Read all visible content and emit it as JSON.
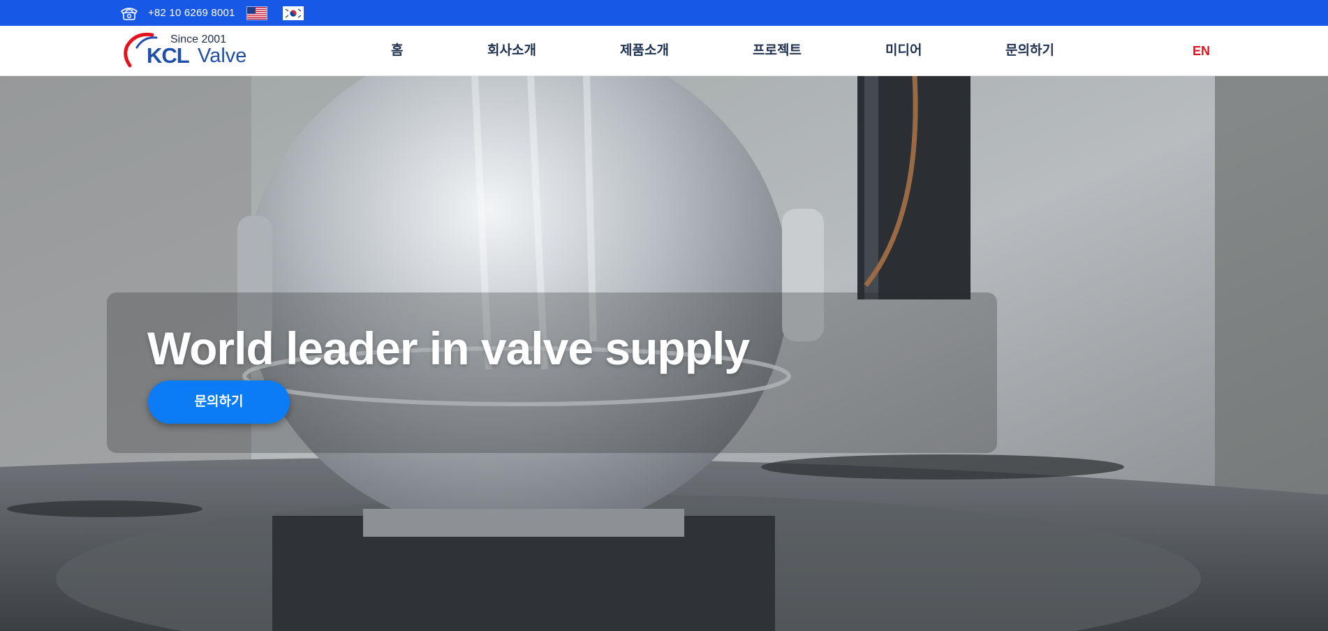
{
  "topbar": {
    "phone_icon": "phone-icon",
    "phone": "+82 10 6269 8001",
    "flags": [
      "us-flag",
      "korea-flag"
    ],
    "background_color": "#1758e6"
  },
  "header": {
    "logo": {
      "since": "Since 2001",
      "brand": "KCL",
      "product": "Valve"
    },
    "nav": [
      "홈",
      "회사소개",
      "제품소개",
      "프로젝트",
      "미디어",
      "문의하기"
    ],
    "language": "EN",
    "language_color": "#e2131d"
  },
  "hero": {
    "title": "World leader in valve supply",
    "cta_label": "문의하기",
    "cta_color": "#0b7cf5"
  }
}
